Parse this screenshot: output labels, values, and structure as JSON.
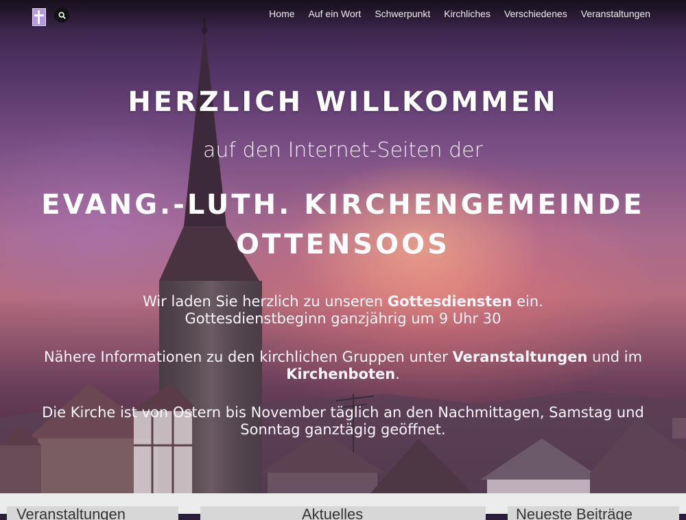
{
  "nav": {
    "items": [
      "Home",
      "Auf ein Wort",
      "Schwerpunkt",
      "Kirchliches",
      "Verschiedenes",
      "Veranstaltungen"
    ]
  },
  "hero": {
    "title": "HERZLICH WILLKOMMEN",
    "subtitle": "auf den Internet-Seiten der",
    "heading_line1": "EVANG.-LUTH. KIRCHENGEMEINDE",
    "heading_line2": "OTTENSOOS",
    "p1_pre": "Wir laden Sie herzlich zu unseren ",
    "p1_bold": "Gottesdiensten",
    "p1_post": " ein.",
    "p1_line2": "Gottesdienstbeginn ganzjährig um 9 Uhr 30",
    "p2_pre": "Nähere Informationen zu den kirchlichen Gruppen unter ",
    "p2_bold1": "Veranstaltungen",
    "p2_mid": " und im",
    "p2_bold2": "Kirchenboten",
    "p2_post": ".",
    "p3_line1": "Die Kirche ist von Ostern bis November täglich an den Nachmittagen, Samstag und",
    "p3_line2": "Sonntag ganztägig geöffnet."
  },
  "cards": [
    "Veranstaltungen",
    "Aktuelles",
    "Neueste Beiträge"
  ],
  "icons": {
    "logo": "cross-logo-icon",
    "search": "search-icon"
  },
  "colors": {
    "logo_bg": "#b49be0",
    "search_bg": "#111111",
    "bottom_bg": "#ececec"
  }
}
